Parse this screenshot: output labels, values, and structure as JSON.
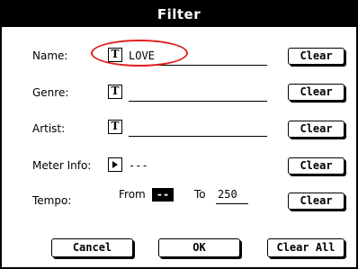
{
  "dialog": {
    "title": "Filter"
  },
  "fields": {
    "name": {
      "label": "Name:",
      "value": "LOVE",
      "clear_label": "Clear",
      "icon": "text-t-icon"
    },
    "genre": {
      "label": "Genre:",
      "value": "",
      "clear_label": "Clear",
      "icon": "text-t-icon"
    },
    "artist": {
      "label": "Artist:",
      "value": "",
      "clear_label": "Clear",
      "icon": "text-t-icon"
    },
    "meter": {
      "label": "Meter Info:",
      "value": "---",
      "clear_label": "Clear",
      "icon": "play-arrow-icon"
    },
    "tempo": {
      "label": "Tempo:",
      "from_label": "From",
      "from_value": "--",
      "to_label": "To",
      "to_value": "250",
      "clear_label": "Clear"
    }
  },
  "buttons": {
    "cancel": "Cancel",
    "ok": "OK",
    "clear_all": "Clear All"
  },
  "annotation": {
    "color": "#e02020"
  }
}
